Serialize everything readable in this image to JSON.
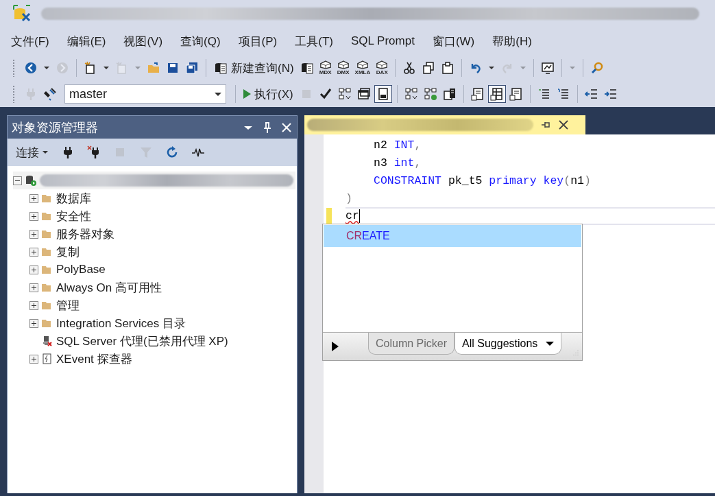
{
  "menu": [
    "文件(F)",
    "编辑(E)",
    "视图(V)",
    "查询(Q)",
    "项目(P)",
    "工具(T)",
    "SQL Prompt",
    "窗口(W)",
    "帮助(H)"
  ],
  "toolbar_1": [
    {
      "kind": "grip"
    },
    {
      "kind": "back",
      "disabled": false
    },
    {
      "kind": "caret",
      "disabled": false
    },
    {
      "kind": "forward",
      "disabled": true
    },
    {
      "kind": "sep"
    },
    {
      "kind": "new-project",
      "disabled": false
    },
    {
      "kind": "caret",
      "disabled": false
    },
    {
      "kind": "add-item",
      "disabled": true
    },
    {
      "kind": "caret",
      "disabled": true
    },
    {
      "kind": "open",
      "disabled": false
    },
    {
      "kind": "save",
      "disabled": false
    },
    {
      "kind": "save-all",
      "disabled": false
    },
    {
      "kind": "sep"
    },
    {
      "kind": "new-query",
      "label": "新建查询(N)",
      "disabled": false
    },
    {
      "kind": "db-query",
      "disabled": false
    },
    {
      "kind": "cube",
      "label": "MDX",
      "disabled": false
    },
    {
      "kind": "cube",
      "label": "DMX",
      "disabled": false
    },
    {
      "kind": "cube",
      "label": "XMLA",
      "disabled": false
    },
    {
      "kind": "cube",
      "label": "DAX",
      "disabled": false
    },
    {
      "kind": "sep"
    },
    {
      "kind": "cut",
      "disabled": false
    },
    {
      "kind": "copy",
      "disabled": false
    },
    {
      "kind": "paste",
      "disabled": false
    },
    {
      "kind": "sep"
    },
    {
      "kind": "undo",
      "disabled": false
    },
    {
      "kind": "caret",
      "disabled": false
    },
    {
      "kind": "redo",
      "disabled": true
    },
    {
      "kind": "caret",
      "disabled": true
    },
    {
      "kind": "sep"
    },
    {
      "kind": "monitor",
      "disabled": false
    },
    {
      "kind": "sep"
    },
    {
      "kind": "caret",
      "disabled": true
    },
    {
      "kind": "sep"
    },
    {
      "kind": "search",
      "disabled": false
    }
  ],
  "toolbar_2": [
    {
      "kind": "grip"
    },
    {
      "kind": "plug",
      "disabled": true
    },
    {
      "kind": "change-connection",
      "disabled": false
    },
    {
      "kind": "combo",
      "value": "master"
    },
    {
      "kind": "sep"
    },
    {
      "kind": "execute",
      "label": "执行(X)",
      "disabled": false
    },
    {
      "kind": "stop",
      "disabled": true
    },
    {
      "kind": "check",
      "disabled": false
    },
    {
      "kind": "plan",
      "disabled": false
    },
    {
      "kind": "window",
      "disabled": false
    },
    {
      "kind": "results",
      "disabled": false,
      "selected": true
    },
    {
      "kind": "sep"
    },
    {
      "kind": "plan",
      "disabled": false
    },
    {
      "kind": "plan-check",
      "disabled": false
    },
    {
      "kind": "stats",
      "disabled": false
    },
    {
      "kind": "sep"
    },
    {
      "kind": "text-results",
      "disabled": false,
      "selected": false
    },
    {
      "kind": "grid-results",
      "disabled": false,
      "selected": true
    },
    {
      "kind": "file-results",
      "disabled": false,
      "selected": false
    },
    {
      "kind": "sep"
    },
    {
      "kind": "comment",
      "disabled": false
    },
    {
      "kind": "uncomment",
      "disabled": false
    },
    {
      "kind": "sep"
    },
    {
      "kind": "outdent",
      "disabled": false
    },
    {
      "kind": "indent",
      "disabled": false
    }
  ],
  "object_explorer": {
    "title": "对象资源管理器",
    "toolbar": [
      {
        "kind": "connect",
        "label": "连接",
        "disabled": false
      },
      {
        "kind": "plug",
        "disabled": false
      },
      {
        "kind": "disconnect",
        "disabled": false
      },
      {
        "kind": "stop",
        "disabled": true
      },
      {
        "kind": "filter",
        "disabled": true
      },
      {
        "kind": "refresh",
        "disabled": false
      },
      {
        "kind": "activity",
        "disabled": false
      }
    ],
    "tree": [
      {
        "kind": "server",
        "expanded": true,
        "children": [
          {
            "kind": "folder",
            "label": "数据库",
            "expanded": false
          },
          {
            "kind": "folder",
            "label": "安全性",
            "expanded": false
          },
          {
            "kind": "folder",
            "label": "服务器对象",
            "expanded": false
          },
          {
            "kind": "folder",
            "label": "复制",
            "expanded": false
          },
          {
            "kind": "folder",
            "label": "PolyBase",
            "expanded": false
          },
          {
            "kind": "folder",
            "label": "Always On 高可用性",
            "expanded": false
          },
          {
            "kind": "folder",
            "label": "管理",
            "expanded": false
          },
          {
            "kind": "folder",
            "label": "Integration Services 目录",
            "expanded": false
          },
          {
            "kind": "agent",
            "label": "SQL Server 代理(已禁用代理 XP)"
          },
          {
            "kind": "xevent",
            "label": "XEvent 探查器",
            "expanded": false
          }
        ]
      }
    ]
  },
  "editor": {
    "lines": [
      {
        "children": [
          {
            "tokens": [
              {
                "text": "n2 ",
                "kind": "plain"
              },
              {
                "text": "INT",
                "kind": "keyword"
              },
              {
                "text": ",",
                "kind": "punct"
              }
            ]
          },
          {
            "tokens": [
              {
                "text": "n3 ",
                "kind": "plain"
              },
              {
                "text": "int",
                "kind": "keyword"
              },
              {
                "text": ",",
                "kind": "punct"
              }
            ]
          },
          {
            "tokens": [
              {
                "text": "CONSTRAINT",
                "kind": "keyword"
              },
              {
                "text": " pk_t5 ",
                "kind": "plain"
              },
              {
                "text": "primary key",
                "kind": "keyword"
              },
              {
                "text": "(",
                "kind": "punct"
              },
              {
                "text": "n1",
                "kind": "plain"
              },
              {
                "text": ")",
                "kind": "punct"
              }
            ]
          }
        ]
      },
      {
        "tokens": [
          {
            "text": ")",
            "kind": "punct"
          }
        ]
      },
      {
        "current": true,
        "tokens": [
          {
            "text": "cr",
            "kind": "error"
          }
        ]
      }
    ],
    "autocomplete": {
      "items": [
        {
          "match": "CR",
          "rest": "EATE",
          "selected": true
        }
      ],
      "tabs": [
        {
          "label": "Column Picker",
          "selected": false
        },
        {
          "label": "All Suggestions",
          "selected": true
        }
      ]
    }
  }
}
